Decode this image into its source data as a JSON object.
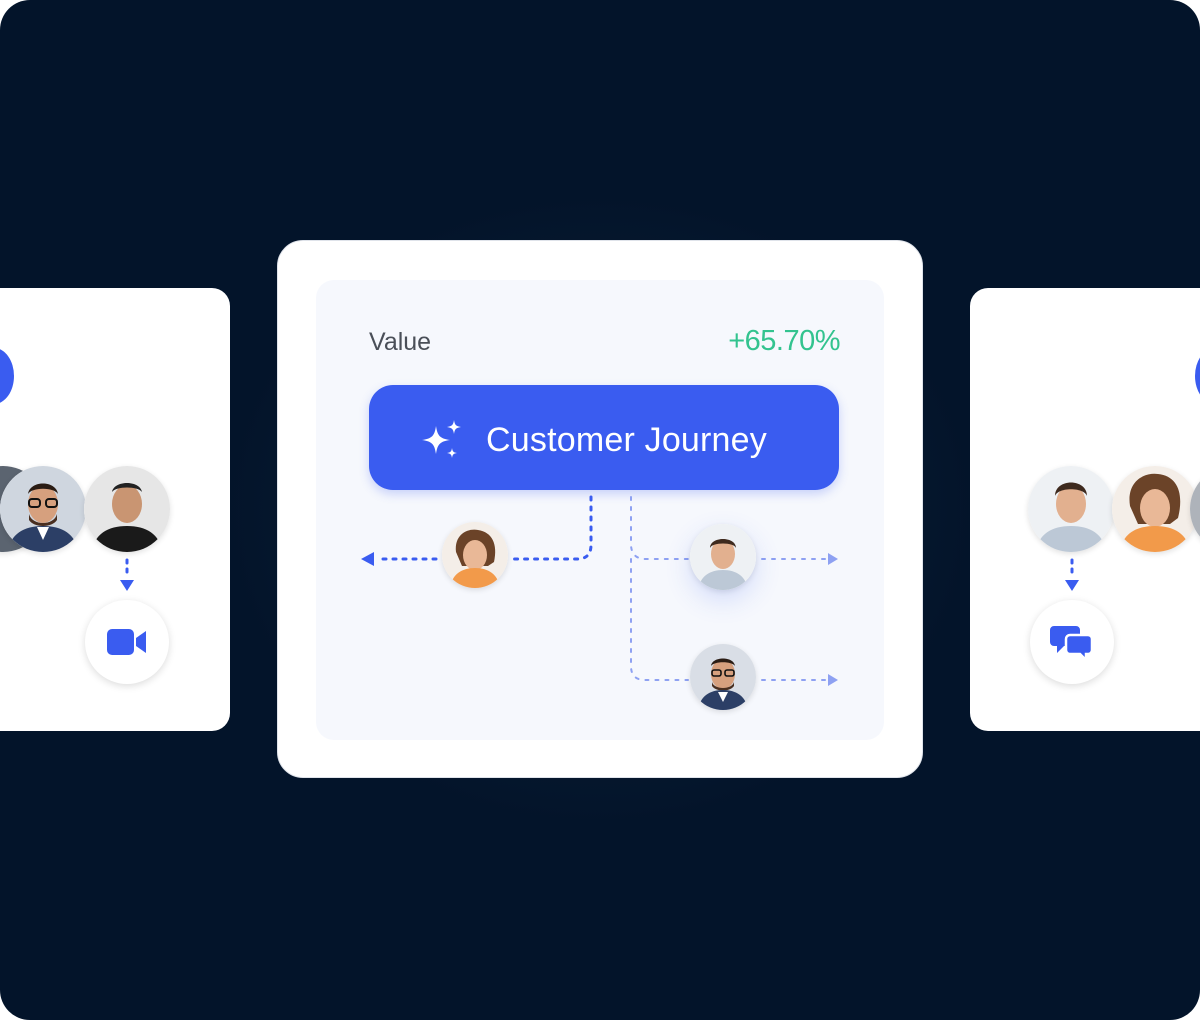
{
  "main": {
    "value_label": "Value",
    "value_change": "+65.70%",
    "journey_label": "Customer Journey"
  },
  "icons": {
    "sparkle": "sparkle-icon",
    "video": "video-camera-icon",
    "chat": "chat-bubbles-icon"
  },
  "colors": {
    "background": "#03142a",
    "accent": "#3a5cf0",
    "positive": "#33c38f",
    "card": "#ffffff",
    "panel": "#f6f8fd"
  }
}
